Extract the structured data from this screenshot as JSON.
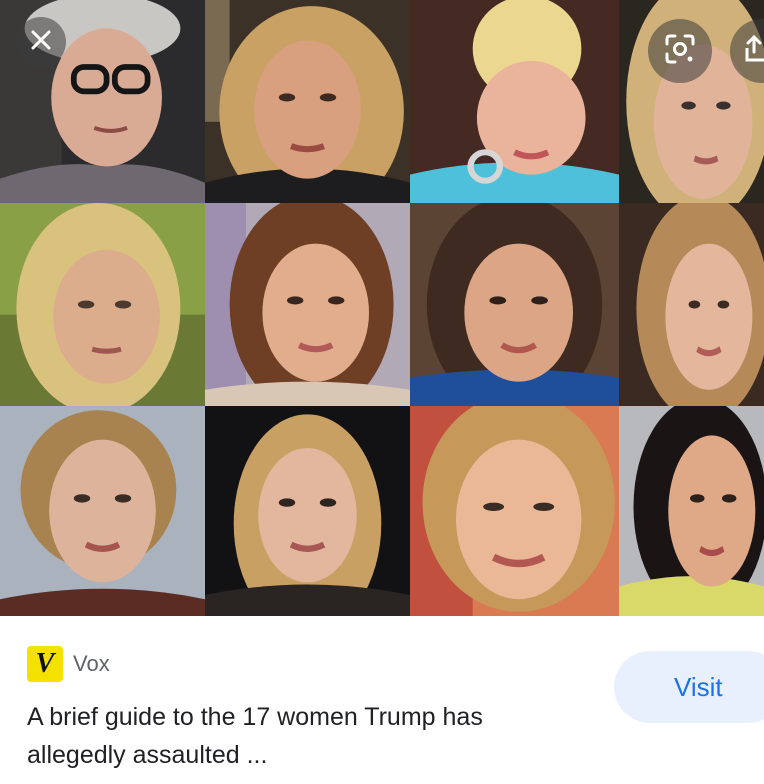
{
  "result": {
    "source": {
      "favicon_letter": "V",
      "favicon_color": "#f5e100",
      "name": "Vox"
    },
    "title": "A brief guide to the 17 women Trump has allegedly assaulted ...",
    "visit_label": "Visit"
  },
  "controls": {
    "close_icon": "close-icon",
    "lens_icon": "lens-search-icon",
    "share_icon": "share-icon"
  },
  "colors": {
    "accent": "#1a73e8",
    "visit_background": "#e8f0fe"
  }
}
